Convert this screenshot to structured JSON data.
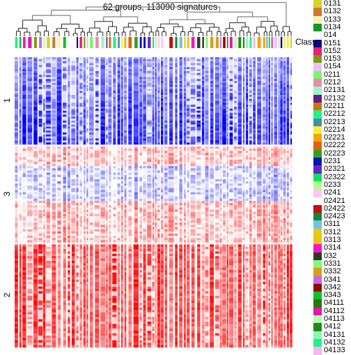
{
  "chart_data": {
    "type": "heatmap",
    "title": "62 groups, 113090 signatures",
    "annotation_label": "Class",
    "row_groups": [
      {
        "label": "1",
        "fraction": 0.305,
        "tone": "blue"
      },
      {
        "label": "3",
        "fraction": 0.335,
        "tone": "mixed"
      },
      {
        "label": "2",
        "fraction": 0.36,
        "tone": "red"
      }
    ],
    "color_scale": {
      "low": "#0000ff",
      "mid": "#ffffff",
      "high": "#ff0000"
    },
    "dendrogram": "hierarchical clustering of columns (top)",
    "legend": [
      {
        "label": "0131",
        "color": "#d4d42a"
      },
      {
        "label": "0132",
        "color": "#d2772f"
      },
      {
        "label": "0133",
        "color": "#fbf2b4"
      },
      {
        "label": "0134",
        "color": "#13972a"
      },
      {
        "label": "014",
        "color": "#ffffff"
      },
      {
        "label": "0151",
        "color": "#060a7a"
      },
      {
        "label": "0152",
        "color": "#ea1e74"
      },
      {
        "label": "0153",
        "color": "#7c9a10"
      },
      {
        "label": "0154",
        "color": "#e6c4f7"
      },
      {
        "label": "0211",
        "color": "#79f56b"
      },
      {
        "label": "0212",
        "color": "#e98ba9"
      },
      {
        "label": "02131",
        "color": "#9ef5c7"
      },
      {
        "label": "02132",
        "color": "#5a1e8e"
      },
      {
        "label": "02211",
        "color": "#d6700c"
      },
      {
        "label": "02212",
        "color": "#1ef48a"
      },
      {
        "label": "02213",
        "color": "#4a8ab0"
      },
      {
        "label": "02214",
        "color": "#f7f03a"
      },
      {
        "label": "02221",
        "color": "#f5a20f"
      },
      {
        "label": "02222",
        "color": "#e0620e"
      },
      {
        "label": "02223",
        "color": "#31a11c"
      },
      {
        "label": "0231",
        "color": "#0a14b4"
      },
      {
        "label": "02321",
        "color": "#6428c2"
      },
      {
        "label": "02322",
        "color": "#0ce35c"
      },
      {
        "label": "0233",
        "color": "#b3fa8e"
      },
      {
        "label": "0241",
        "color": "#fcc6f7"
      },
      {
        "label": "02421",
        "color": "#ffffff"
      },
      {
        "label": "02422",
        "color": "#c80c10"
      },
      {
        "label": "02423",
        "color": "#0c8a3c"
      },
      {
        "label": "0311",
        "color": "#78c0e0"
      },
      {
        "label": "0312",
        "color": "#e8cc0c"
      },
      {
        "label": "0313",
        "color": "#e8c414"
      },
      {
        "label": "0314",
        "color": "#f814c8"
      },
      {
        "label": "032",
        "color": "#2c3c28"
      },
      {
        "label": "0331",
        "color": "#86f582"
      },
      {
        "label": "0332",
        "color": "#d8a012"
      },
      {
        "label": "0341",
        "color": "#c866e8"
      },
      {
        "label": "0342",
        "color": "#960008"
      },
      {
        "label": "0343",
        "color": "#0cc22c"
      },
      {
        "label": "04111",
        "color": "#257a0c"
      },
      {
        "label": "04112",
        "color": "#e416a8"
      },
      {
        "label": "04113",
        "color": "#b6fab4"
      },
      {
        "label": "0412",
        "color": "#248a14"
      },
      {
        "label": "04131",
        "color": "#86f8b8"
      },
      {
        "label": "04132",
        "color": "#1ef486"
      },
      {
        "label": "04133",
        "color": "#f4b6ee"
      }
    ],
    "columns": [
      "02212",
      "0343",
      "0314",
      "04112",
      "0153",
      "0341",
      "04113",
      "0131",
      "0132",
      "0133",
      "0343",
      "014",
      "014",
      "0151",
      "0152",
      "0153",
      "0154",
      "0211",
      "0212",
      "02131",
      "02132",
      "02211",
      "02212",
      "02213",
      "02214",
      "02221",
      "02222",
      "02223",
      "0231",
      "0231",
      "02321",
      "02322",
      "0233",
      "0241",
      "0241",
      "02421",
      "02422",
      "02423",
      "0311",
      "0312",
      "0313",
      "0314",
      "032",
      "032",
      "0331",
      "0332",
      "0332",
      "0341",
      "0342",
      "04111",
      "04112",
      "04113",
      "0412",
      "0412",
      "04131",
      "04132",
      "04133",
      "02221",
      "02221",
      "02213",
      "02322",
      "04112",
      "0154",
      "0154",
      "0151",
      "02214",
      "02214",
      "0131"
    ]
  }
}
